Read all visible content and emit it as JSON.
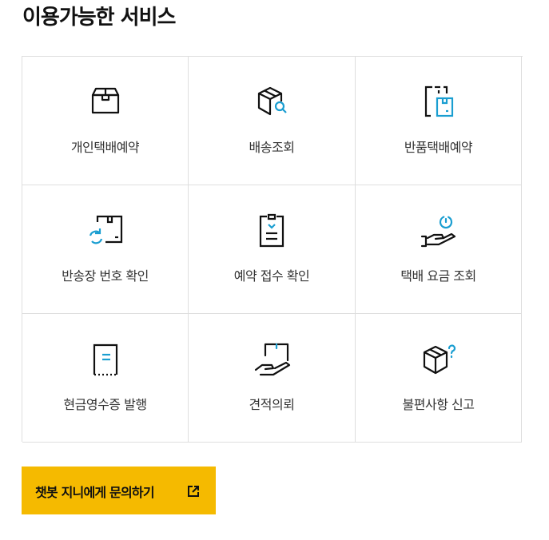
{
  "page": {
    "title": "이용가능한 서비스"
  },
  "colors": {
    "accent": "#1a9ed1",
    "stroke": "#111111",
    "button_bg": "#f5ba00",
    "border": "#dedede"
  },
  "services": [
    {
      "label": "개인택배예약",
      "icon": "box-icon"
    },
    {
      "label": "배송조회",
      "icon": "box-search-icon"
    },
    {
      "label": "반품택배예약",
      "icon": "return-box-icon"
    },
    {
      "label": "반송장 번호 확인",
      "icon": "box-refresh-icon"
    },
    {
      "label": "예약 접수 확인",
      "icon": "clipboard-check-icon"
    },
    {
      "label": "택배 요금 조회",
      "icon": "hand-coin-icon"
    },
    {
      "label": "현금영수증 발행",
      "icon": "receipt-icon"
    },
    {
      "label": "견적의뢰",
      "icon": "hand-box-icon"
    },
    {
      "label": "불편사항 신고",
      "icon": "box-question-icon"
    }
  ],
  "chatbot": {
    "label": "챗봇 지니에게 문의하기",
    "icon": "external-link-icon"
  }
}
